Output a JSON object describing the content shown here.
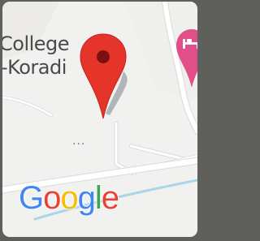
{
  "map": {
    "place_label_line1": "College",
    "place_label_line2": "-Koradi",
    "more_indicator": "...",
    "brand": {
      "letters": [
        {
          "char": "G",
          "color": "#4285F4"
        },
        {
          "char": "o",
          "color": "#EA4335"
        },
        {
          "char": "o",
          "color": "#FBBC05"
        },
        {
          "char": "g",
          "color": "#4285F4"
        },
        {
          "char": "l",
          "color": "#34A853"
        },
        {
          "char": "e",
          "color": "#EA4335"
        }
      ]
    },
    "selected_pin": {
      "icon": "red-location-pin-icon",
      "color": "#E5352B"
    },
    "poi_pin": {
      "icon": "hotel-pin-icon",
      "color": "#E14F8A"
    },
    "colors": {
      "background": "#F1F1EF",
      "road": "#FFFFFF",
      "road_outline": "#D9DBDC",
      "water": "#A8D6EB"
    }
  }
}
